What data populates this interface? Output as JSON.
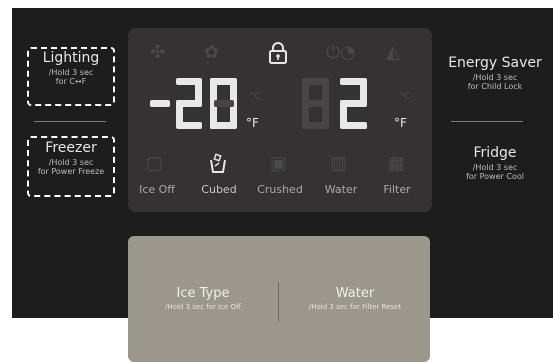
{
  "left": {
    "lighting": {
      "label": "Lighting",
      "sub1": "/Hold 3 sec",
      "sub2": "for C↔F"
    },
    "freezer": {
      "label": "Freezer",
      "sub1": "/Hold 3 sec",
      "sub2": "for Power Freeze"
    }
  },
  "right": {
    "energy_saver": {
      "label": "Energy Saver",
      "sub1": "/Hold 3 sec",
      "sub2": "for Child Lock"
    },
    "fridge": {
      "label": "Fridge",
      "sub1": "/Hold 3 sec",
      "sub2": "for Power Cool"
    }
  },
  "display": {
    "freezer_temp": "-20",
    "fridge_temp": "2",
    "unit": "°F",
    "unit_dim": "°C",
    "ice_modes": [
      "Ice Off",
      "Cubed",
      "Crushed",
      "Water",
      "Filter"
    ],
    "selected_mode": "Cubed"
  },
  "lower": {
    "ice_type": {
      "label": "Ice Type",
      "sub": "/Hold 3 sec for Ice Off"
    },
    "water": {
      "label": "Water",
      "sub": "/Hold 3 sec for Filter Reset"
    }
  }
}
